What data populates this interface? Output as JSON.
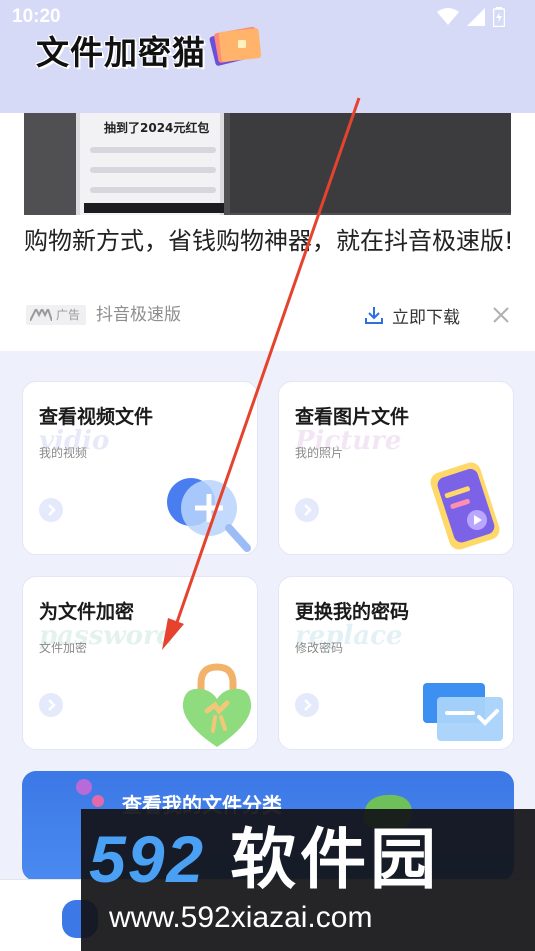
{
  "status_bar": {
    "time": "10:20"
  },
  "header": {
    "app_title": "文件加密猫"
  },
  "ad": {
    "image_text": "抽到了2024元红包",
    "title": "购物新方式，省钱购物神器，就在抖音极速版!",
    "badge": "广告",
    "source": "抖音极速版",
    "download_label": "立即下载"
  },
  "features": [
    {
      "title": "查看视频文件",
      "watermark": "vidio",
      "subtitle": "我的视频",
      "watermark_color": "#e6eaf8"
    },
    {
      "title": "查看图片文件",
      "watermark": "Picture",
      "subtitle": "我的照片",
      "watermark_color": "#f3e6f4"
    },
    {
      "title": "为文件加密",
      "watermark": "password",
      "subtitle": "文件加密",
      "watermark_color": "#e3f3ec"
    },
    {
      "title": "更换我的密码",
      "watermark": "replace",
      "subtitle": "修改密码",
      "watermark_color": "#e3f1f6"
    }
  ],
  "banner": {
    "title": "查看我的文件分类"
  },
  "site_watermark": {
    "digits": "592",
    "name": "软件园",
    "url": "www.592xiazai.com"
  },
  "colors": {
    "header_bg": "#d6daf7",
    "accent_blue": "#3c78e6",
    "annotation_red": "#e5432d"
  }
}
